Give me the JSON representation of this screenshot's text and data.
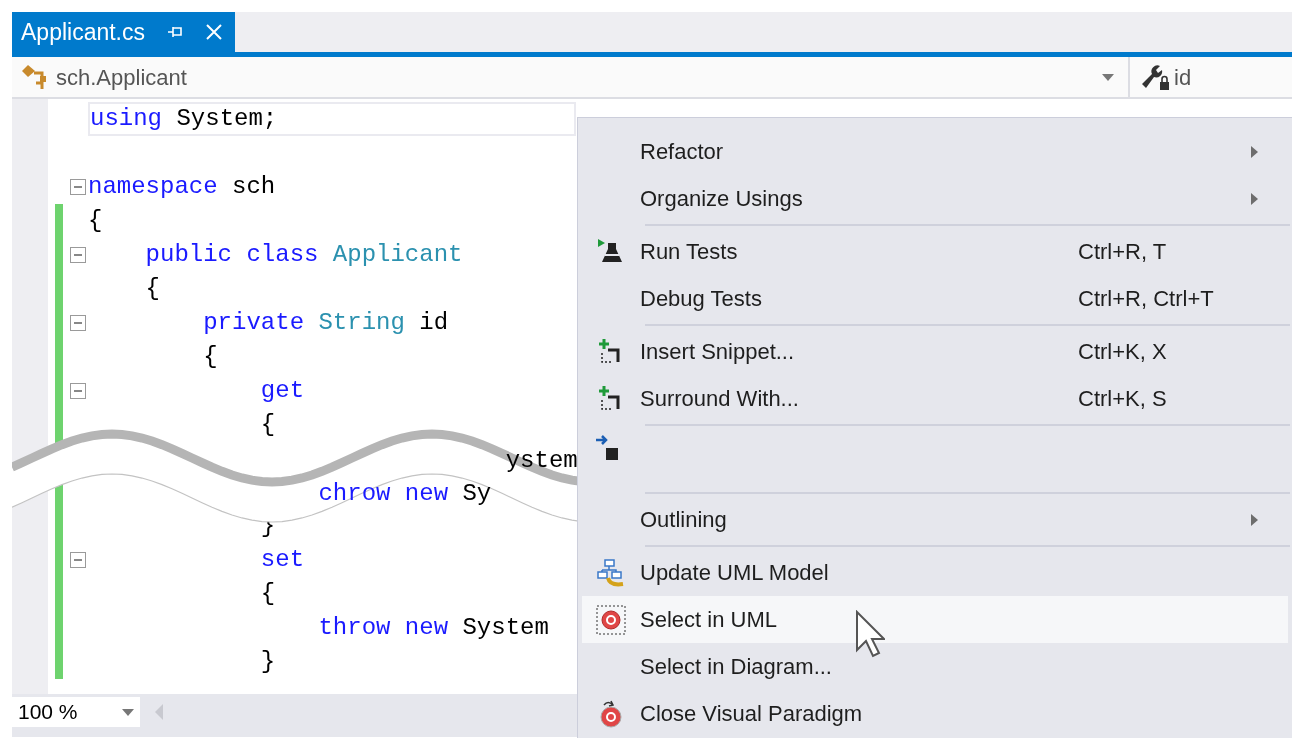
{
  "tab": {
    "title": "Applicant.cs",
    "selected": true
  },
  "navigation": {
    "type_scope": "sch.Applicant",
    "member": "id"
  },
  "code": {
    "lines": [
      {
        "kind": "line",
        "current": true,
        "changed": false,
        "fold": false,
        "tokens": [
          {
            "kind": "keyword",
            "text": "using"
          },
          {
            "kind": "plain",
            "text": " System;"
          }
        ]
      },
      {
        "kind": "line",
        "current": false,
        "changed": false,
        "fold": false
      },
      {
        "kind": "line",
        "current": false,
        "changed": false,
        "fold": true,
        "tokens": [
          {
            "kind": "keyword",
            "text": "namespace"
          },
          {
            "kind": "plain",
            "text": " sch"
          }
        ]
      },
      {
        "kind": "line",
        "current": false,
        "changed": true,
        "fold": false,
        "tokens": [
          {
            "kind": "plain",
            "text": "{"
          }
        ]
      },
      {
        "kind": "line",
        "current": false,
        "changed": true,
        "fold": true,
        "tokens": [
          {
            "kind": "keyword",
            "text": "    public class "
          },
          {
            "kind": "type",
            "text": "Applicant"
          }
        ]
      },
      {
        "kind": "line",
        "current": false,
        "changed": true,
        "fold": false,
        "tokens": [
          {
            "kind": "plain",
            "text": "    {"
          }
        ]
      },
      {
        "kind": "line",
        "current": false,
        "changed": true,
        "fold": true,
        "tokens": [
          {
            "kind": "keyword",
            "text": "        private "
          },
          {
            "kind": "type",
            "text": "String"
          },
          {
            "kind": "plain",
            "text": " id"
          }
        ]
      },
      {
        "kind": "line",
        "current": false,
        "changed": true,
        "fold": false,
        "tokens": [
          {
            "kind": "plain",
            "text": "        {"
          }
        ]
      },
      {
        "kind": "line",
        "current": false,
        "changed": true,
        "fold": true,
        "tokens": [
          {
            "kind": "keyword",
            "text": "            get"
          }
        ]
      },
      {
        "kind": "line",
        "current": false,
        "changed": true,
        "fold": false,
        "tokens": [
          {
            "kind": "plain",
            "text": "            {"
          }
        ]
      },
      {
        "kind": "gap",
        "changed": true,
        "fragments": [
          {
            "tokens": [
              {
                "kind": "plain",
                "text": "                             ystem"
              }
            ]
          },
          {
            "tokens": [
              {
                "kind": "keyword",
                "text": "                chrow new"
              },
              {
                "kind": "plain",
                "text": " Sy"
              }
            ]
          }
        ]
      },
      {
        "kind": "line",
        "current": false,
        "changed": true,
        "fold": false,
        "tokens": [
          {
            "kind": "plain",
            "text": "            }"
          }
        ]
      },
      {
        "kind": "line",
        "current": false,
        "changed": true,
        "fold": true,
        "tokens": [
          {
            "kind": "keyword",
            "text": "            set"
          }
        ]
      },
      {
        "kind": "line",
        "current": false,
        "changed": true,
        "fold": false,
        "tokens": [
          {
            "kind": "plain",
            "text": "            {"
          }
        ]
      },
      {
        "kind": "line",
        "current": false,
        "changed": true,
        "fold": false,
        "tokens": [
          {
            "kind": "keyword",
            "text": "                throw new"
          },
          {
            "kind": "plain",
            "text": " System"
          }
        ]
      },
      {
        "kind": "line",
        "current": false,
        "changed": true,
        "fold": false,
        "tokens": [
          {
            "kind": "plain",
            "text": "            }"
          }
        ]
      }
    ]
  },
  "zoom": {
    "value": "100 %"
  },
  "context_menu": {
    "items": [
      {
        "kind": "item",
        "label": "Refactor",
        "submenu": true,
        "selected": false
      },
      {
        "kind": "item",
        "label": "Organize Usings",
        "submenu": true,
        "selected": false
      },
      {
        "kind": "separator"
      },
      {
        "kind": "test",
        "label": "Run Tests",
        "shortcut": "Ctrl+R, T",
        "submenu": false,
        "selected": false
      },
      {
        "kind": "item",
        "label": "Debug Tests",
        "shortcut": "Ctrl+R, Ctrl+T",
        "submenu": false,
        "selected": false
      },
      {
        "kind": "separator"
      },
      {
        "kind": "snippet",
        "label": "Insert Snippet...",
        "shortcut": "Ctrl+K, X",
        "submenu": false,
        "selected": false
      },
      {
        "kind": "snippet",
        "label": "Surround With...",
        "shortcut": "Ctrl+K, S",
        "submenu": false,
        "selected": false
      },
      {
        "kind": "separator"
      },
      {
        "kind": "gap"
      },
      {
        "kind": "separator"
      },
      {
        "kind": "item",
        "label": "Outlining",
        "submenu": true,
        "selected": false
      },
      {
        "kind": "separator"
      },
      {
        "kind": "model",
        "label": "Update UML Model",
        "submenu": false,
        "selected": false
      },
      {
        "kind": "locate",
        "label": "Select in UML",
        "submenu": false,
        "selected": true
      },
      {
        "kind": "item",
        "label": "Select in Diagram...",
        "submenu": false,
        "selected": false
      },
      {
        "kind": "exit",
        "label": "Close Visual Paradigm",
        "submenu": false,
        "selected": false
      }
    ]
  }
}
